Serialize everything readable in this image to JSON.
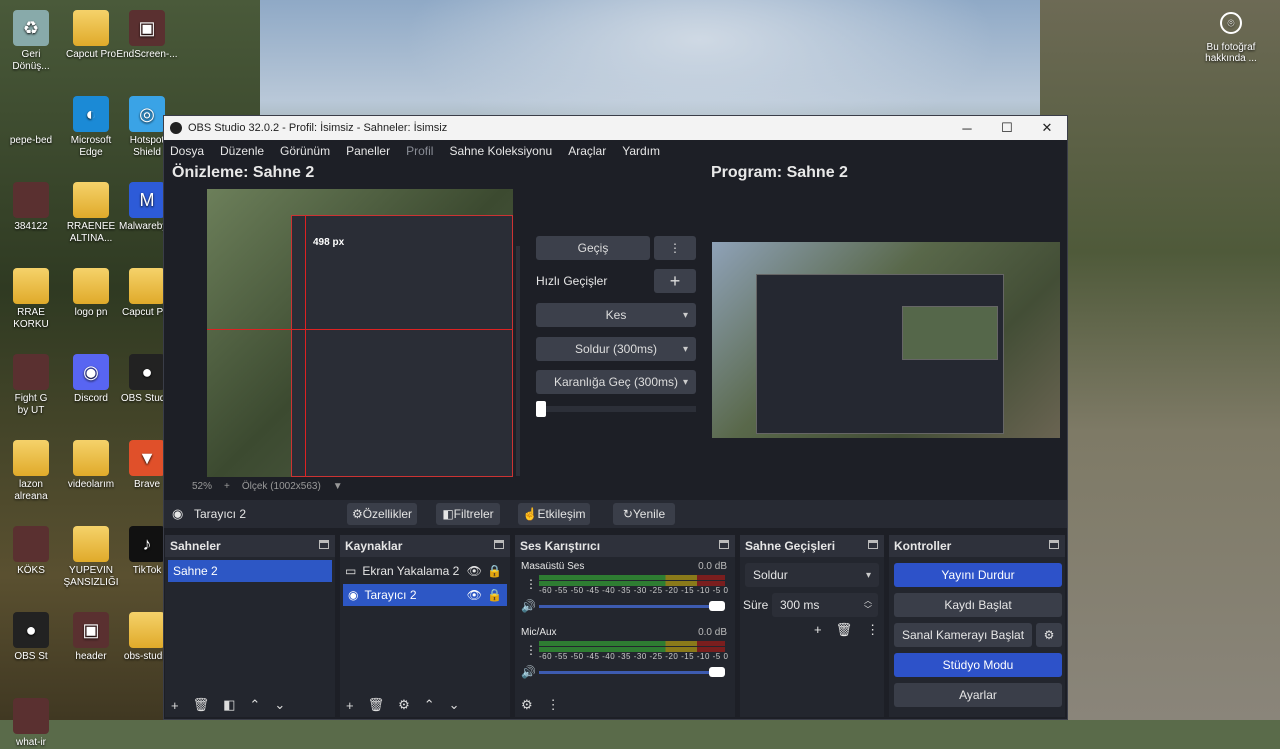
{
  "desktop": {
    "icons": [
      {
        "label": "Geri\nDönüş...",
        "glyph": "♻",
        "kind": "recycle"
      },
      {
        "label": "Capcut Pro",
        "glyph": "",
        "kind": "folder"
      },
      {
        "label": "EndScreen-...",
        "glyph": "▣",
        "kind": "image"
      },
      {
        "label": "pepe-bed",
        "glyph": "",
        "kind": "blank"
      },
      {
        "label": "Microsoft\nEdge",
        "glyph": "◐",
        "kind": "edge"
      },
      {
        "label": "Hotspot\nShield",
        "glyph": "◎",
        "kind": "hotspot"
      },
      {
        "label": "384122",
        "glyph": "",
        "kind": "image"
      },
      {
        "label": "RRAENEE\nALTINA...",
        "glyph": "",
        "kind": "folder"
      },
      {
        "label": "Malwareby...",
        "glyph": "M",
        "kind": "malware"
      },
      {
        "label": "RRAE\nKORKU",
        "glyph": "",
        "kind": "folder"
      },
      {
        "label": "logo pn",
        "glyph": "",
        "kind": "folder"
      },
      {
        "label": "Capcut Pro",
        "glyph": "",
        "kind": "folder"
      },
      {
        "label": "Fight G\nby UT",
        "glyph": "",
        "kind": "image"
      },
      {
        "label": "Discord",
        "glyph": "◉",
        "kind": "discord"
      },
      {
        "label": "OBS Studio",
        "glyph": "●",
        "kind": "obs"
      },
      {
        "label": "lazon\nalreana",
        "glyph": "",
        "kind": "folder"
      },
      {
        "label": "videolarım",
        "glyph": "",
        "kind": "folder"
      },
      {
        "label": "Brave",
        "glyph": "▼",
        "kind": "brave"
      },
      {
        "label": "KÖKS",
        "glyph": "",
        "kind": "image"
      },
      {
        "label": "YUPEVIN\nŞANSIZLIĞI",
        "glyph": "",
        "kind": "folder"
      },
      {
        "label": "TikTok",
        "glyph": "♪",
        "kind": "tiktok"
      },
      {
        "label": "OBS St",
        "glyph": "●",
        "kind": "obs"
      },
      {
        "label": "header",
        "glyph": "▣",
        "kind": "image"
      },
      {
        "label": "obs-studio",
        "glyph": "",
        "kind": "folder"
      },
      {
        "label": "what-ir",
        "glyph": "",
        "kind": "image"
      }
    ],
    "about_label": "Bu fotoğraf\nhakkında ..."
  },
  "window": {
    "title": "OBS Studio 32.0.2 - Profil: İsimsiz - Sahneler: İsimsiz",
    "menu": [
      "Dosya",
      "Düzenle",
      "Görünüm",
      "Paneller",
      "Profil",
      "Sahne Koleksiyonu",
      "Araçlar",
      "Yardım"
    ],
    "preview_title": "Önizleme: Sahne 2",
    "program_title": "Program: Sahne 2",
    "preview_zoom": "52%",
    "preview_scale": "Ölçek (1002x563)",
    "preview_size_label": "498 px"
  },
  "transitions": {
    "geçis": "Geçiş",
    "quick_label": "Hızlı Geçişler",
    "items": [
      "Kes",
      "Soldur (300ms)",
      "Karanlığa Geç (300ms)"
    ]
  },
  "toolbar": {
    "source_name": "Tarayıcı 2",
    "buttons": [
      "Özellikler",
      "Filtreler",
      "Etkileşim",
      "Yenile"
    ]
  },
  "docks": {
    "scenes": {
      "title": "Sahneler",
      "items": [
        "Sahne 2"
      ]
    },
    "sources": {
      "title": "Kaynaklar",
      "items": [
        "Ekran Yakalama 2",
        "Tarayıcı 2"
      ]
    },
    "mixer": {
      "title": "Ses Karıştırıcı",
      "channels": [
        {
          "name": "Masaüstü Ses",
          "db": "0.0 dB"
        },
        {
          "name": "Mic/Aux",
          "db": "0.0 dB"
        }
      ],
      "ticks": "-60 -55 -50 -45 -40 -35 -30 -25 -20 -15 -10 -5 0"
    },
    "transitions": {
      "title": "Sahne Geçişleri",
      "selected": "Soldur",
      "duration_label": "Süre",
      "duration": "300 ms"
    },
    "controls": {
      "title": "Kontroller",
      "buttons": [
        "Yayını Durdur",
        "Kaydı Başlat",
        "Sanal Kamerayı Başlat",
        "Stüdyo Modu",
        "Ayarlar"
      ]
    }
  },
  "colors": {
    "accent": "#2d52c9",
    "panel": "#23262e",
    "window": "#1d1f26"
  }
}
